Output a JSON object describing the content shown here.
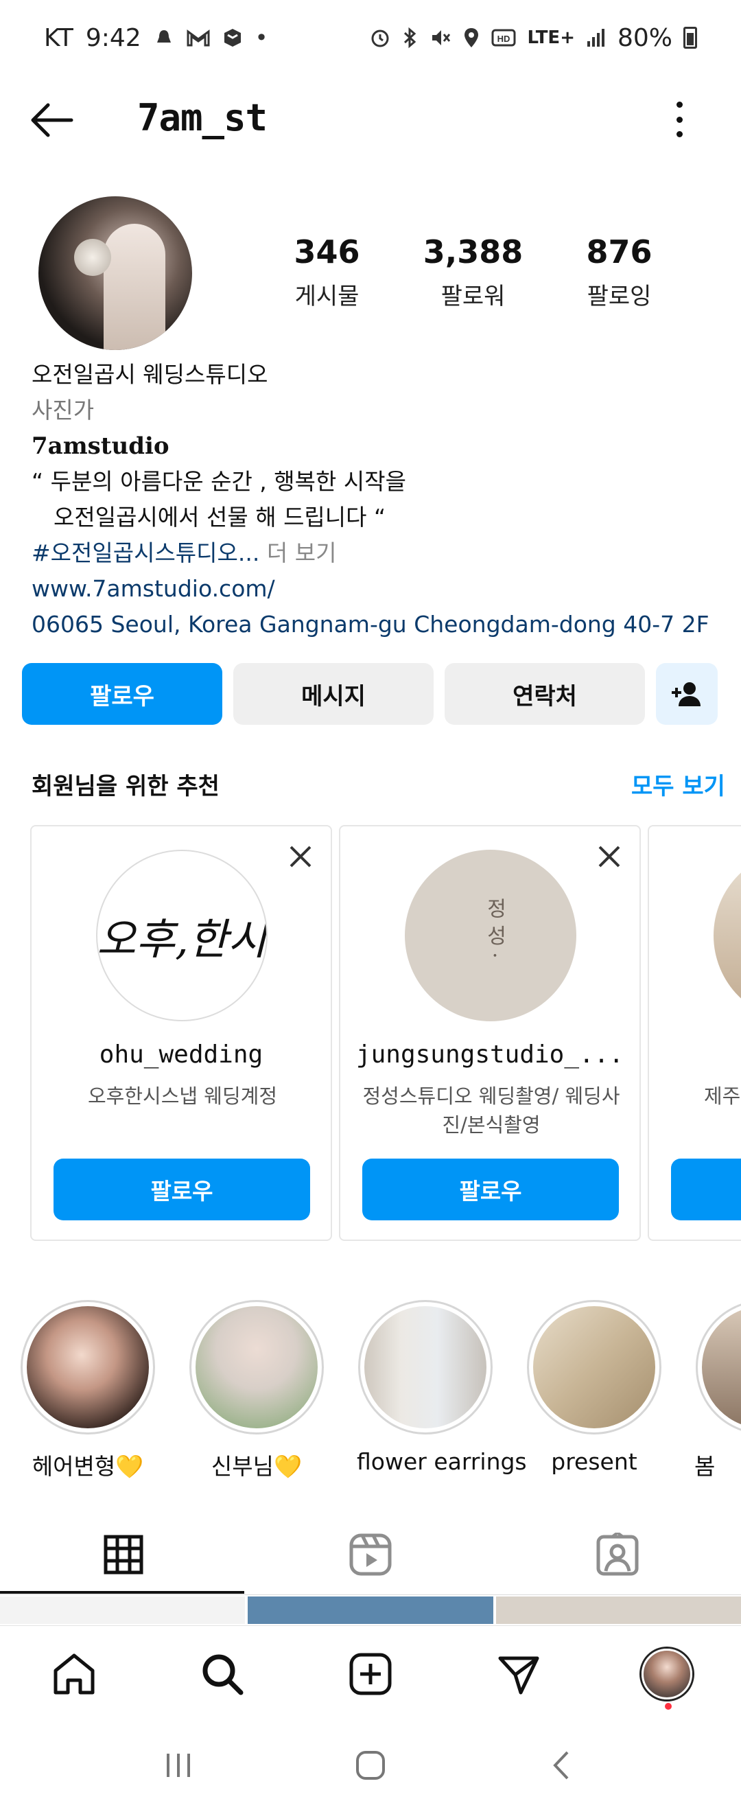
{
  "status_bar": {
    "carrier": "KT",
    "time": "9:42",
    "network": "LTE+",
    "battery_percent": "80%"
  },
  "header": {
    "username": "7am_st"
  },
  "profile": {
    "stats": [
      {
        "value": "346",
        "label": "게시물"
      },
      {
        "value": "3,388",
        "label": "팔로워"
      },
      {
        "value": "876",
        "label": "팔로잉"
      }
    ],
    "bio": {
      "name": "오전일곱시 웨딩스튜디오",
      "category": "사진가",
      "brand": "7amstudio",
      "line1": "“ 두분의 아름다운 순간 , 행복한 시작을",
      "line2": "오전일곱시에서 선물 해 드립니다 “",
      "hashtag": "#오전일곱시스튜디오...",
      "more": "더 보기",
      "link": "www.7amstudio.com/",
      "address": "06065 Seoul, Korea Gangnam-gu Cheongdam-dong  40-7 2F"
    }
  },
  "actions": {
    "follow": "팔로우",
    "message": "메시지",
    "contact": "연락처"
  },
  "suggestions": {
    "title": "회원님을 위한 추천",
    "see_all": "모두 보기",
    "cards": [
      {
        "handle": "ohu_wedding",
        "subtitle": "오후한시스냅 웨딩계정",
        "avatar_text": "오후,한시",
        "follow": "팔로우"
      },
      {
        "handle": "jungsungstudio_...",
        "subtitle": "정성스튜디오 웨딩촬영/ 웨딩사진/본식촬영",
        "avatar_text": "정 성 ·",
        "follow": "팔로우"
      },
      {
        "handle": "",
        "subtitle": "제주",
        "follow": ""
      }
    ]
  },
  "highlights": [
    {
      "label": "헤어변형💛"
    },
    {
      "label": "신부님💛"
    },
    {
      "label": "flower earrings"
    },
    {
      "label": "present"
    },
    {
      "label": "봄"
    }
  ],
  "colors": {
    "accent": "#0095f6",
    "link": "#0b3a6b",
    "button_gray": "#efefef"
  }
}
